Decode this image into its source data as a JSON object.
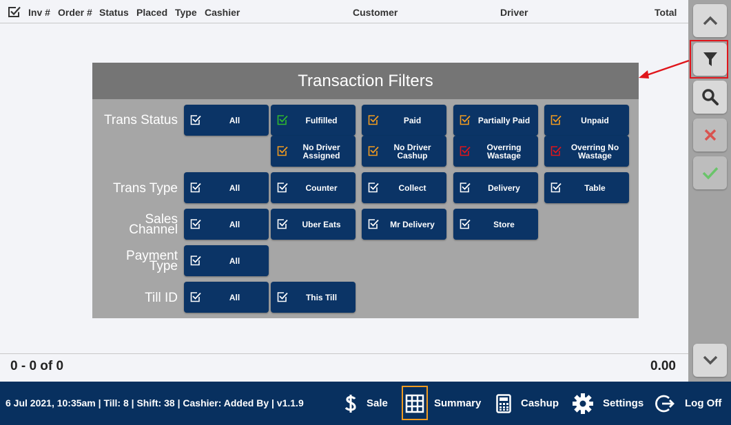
{
  "header": {
    "columns": [
      "Inv #",
      "Order #",
      "Status",
      "Placed",
      "Type",
      "Cashier",
      "Customer",
      "Driver",
      "Total"
    ]
  },
  "summary": {
    "count": "0 - 0 of 0",
    "total": "0.00"
  },
  "dialog": {
    "title": "Transaction Filters",
    "rows": [
      {
        "label": "Trans Status",
        "buttons": [
          {
            "label": "All",
            "color": "#ffffff"
          },
          {
            "label": "Fulfilled",
            "color": "#2eb82e"
          },
          {
            "label": "Paid",
            "color": "#f29b1f"
          },
          {
            "label": "Partially Paid",
            "color": "#f29b1f"
          },
          {
            "label": "Unpaid",
            "color": "#f29b1f"
          },
          {
            "label": "No Driver Assigned",
            "color": "#f29b1f"
          },
          {
            "label": "No Driver Cashup",
            "color": "#f29b1f"
          },
          {
            "label": "Overring Wastage",
            "color": "#e0151b"
          },
          {
            "label": "Overring No Wastage",
            "color": "#e0151b"
          }
        ]
      },
      {
        "label": "Trans Type",
        "buttons": [
          {
            "label": "All",
            "color": "#ffffff"
          },
          {
            "label": "Counter",
            "color": "#ffffff"
          },
          {
            "label": "Collect",
            "color": "#ffffff"
          },
          {
            "label": "Delivery",
            "color": "#ffffff"
          },
          {
            "label": "Table",
            "color": "#ffffff"
          }
        ]
      },
      {
        "label": "Sales Channel",
        "buttons": [
          {
            "label": "All",
            "color": "#ffffff"
          },
          {
            "label": "Uber Eats",
            "color": "#ffffff"
          },
          {
            "label": "Mr Delivery",
            "color": "#ffffff"
          },
          {
            "label": "Store",
            "color": "#ffffff"
          }
        ]
      },
      {
        "label": "Payment Type",
        "buttons": [
          {
            "label": "All",
            "color": "#ffffff"
          }
        ]
      },
      {
        "label": "Till ID",
        "buttons": [
          {
            "label": "All",
            "color": "#ffffff"
          },
          {
            "label": "This Till",
            "color": "#ffffff"
          }
        ]
      }
    ]
  },
  "rail": {
    "buttons": [
      "chevron-up-icon",
      "filter-icon",
      "search-icon",
      "cancel-x-icon",
      "confirm-check-icon",
      "chevron-down-icon"
    ]
  },
  "footer": {
    "status": "6 Jul 2021, 10:35am | Till: 8 | Shift: 38 | Cashier: Added By | v1.1.9",
    "nav": [
      {
        "label": "Sale",
        "icon": "dollar-icon"
      },
      {
        "label": "Summary",
        "icon": "grid-icon"
      },
      {
        "label": "Cashup",
        "icon": "calculator-icon"
      },
      {
        "label": "Settings",
        "icon": "gear-icon"
      },
      {
        "label": "Log Off",
        "icon": "logout-icon"
      }
    ]
  },
  "colors": {
    "navy": "#0b3466",
    "bar": "#08305f",
    "highlight": "#e0151b",
    "summary_box": "#f29b1f"
  }
}
